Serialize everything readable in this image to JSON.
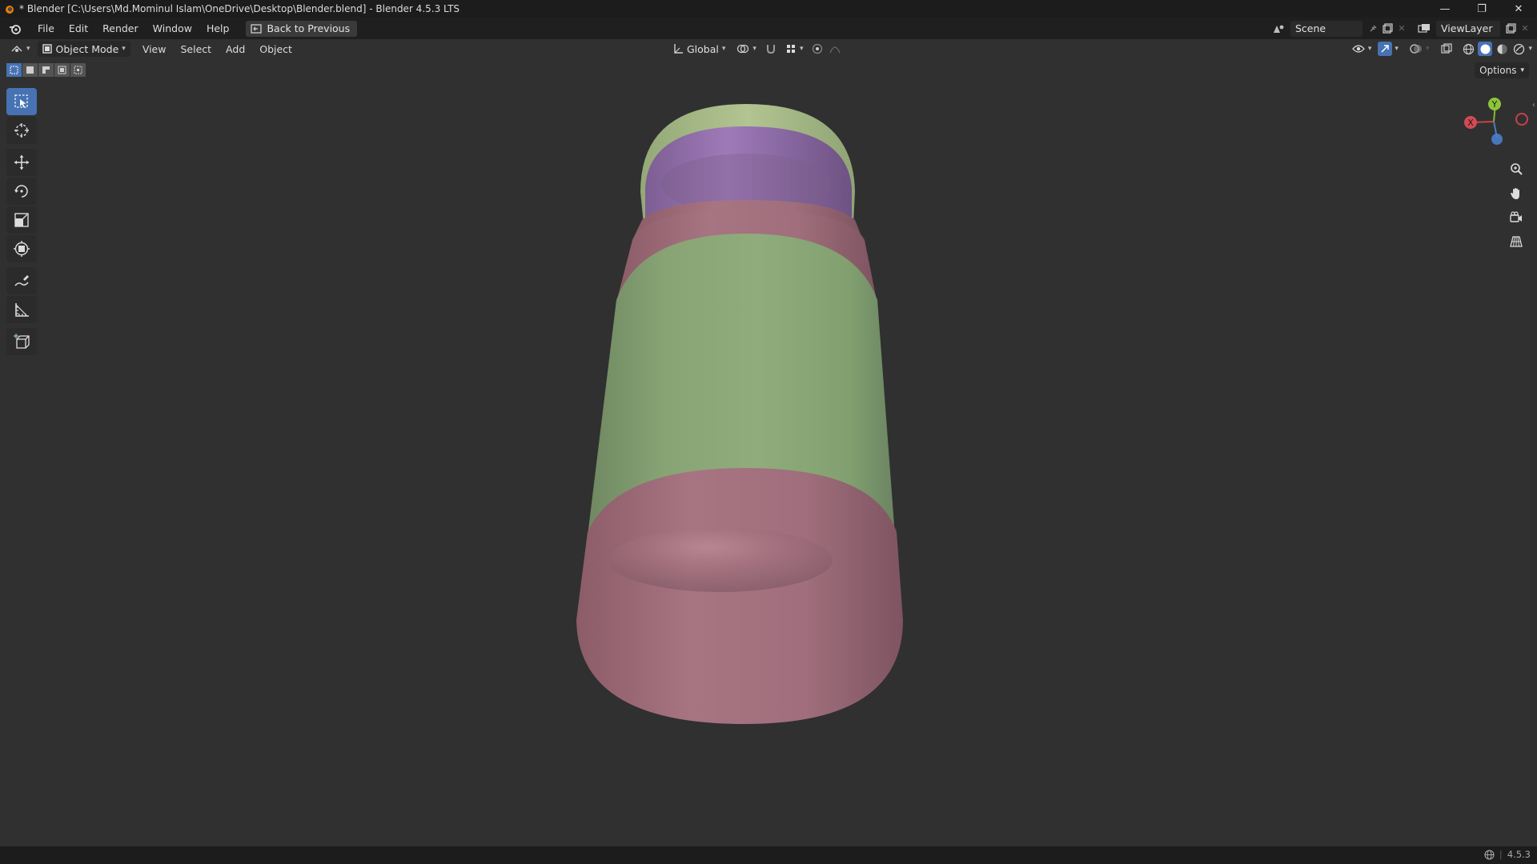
{
  "window": {
    "title": "* Blender [C:\\Users\\Md.Mominul Islam\\OneDrive\\Desktop\\Blender.blend] - Blender 4.5.3 LTS",
    "minimize": "—",
    "maximize": "❐",
    "close": "✕"
  },
  "menubar": {
    "items": [
      "File",
      "Edit",
      "Render",
      "Window",
      "Help"
    ],
    "back_button": "Back to Previous",
    "scene": "Scene",
    "view_layer": "ViewLayer"
  },
  "viewport_header": {
    "mode": "Object Mode",
    "menus": [
      "View",
      "Select",
      "Add",
      "Object"
    ],
    "orientation": "Global"
  },
  "options_label": "Options",
  "gizmo": {
    "y": "Y",
    "x": "X"
  },
  "status": {
    "version": "4.5.3"
  },
  "colors": {
    "accent": "#4772b3",
    "object_green": "#8ea87a",
    "object_pink": "#a4707e",
    "object_purple": "#9873b0",
    "viewport_bg": "#303030"
  },
  "icons": {
    "toolbar": [
      "select-box-icon",
      "cursor-icon",
      "move-icon",
      "rotate-icon",
      "scale-icon",
      "transform-icon",
      "annotate-icon",
      "measure-icon",
      "add-cube-icon"
    ],
    "nav": [
      "zoom-icon",
      "pan-hand-icon",
      "camera-view-icon",
      "perspective-grid-icon"
    ]
  }
}
